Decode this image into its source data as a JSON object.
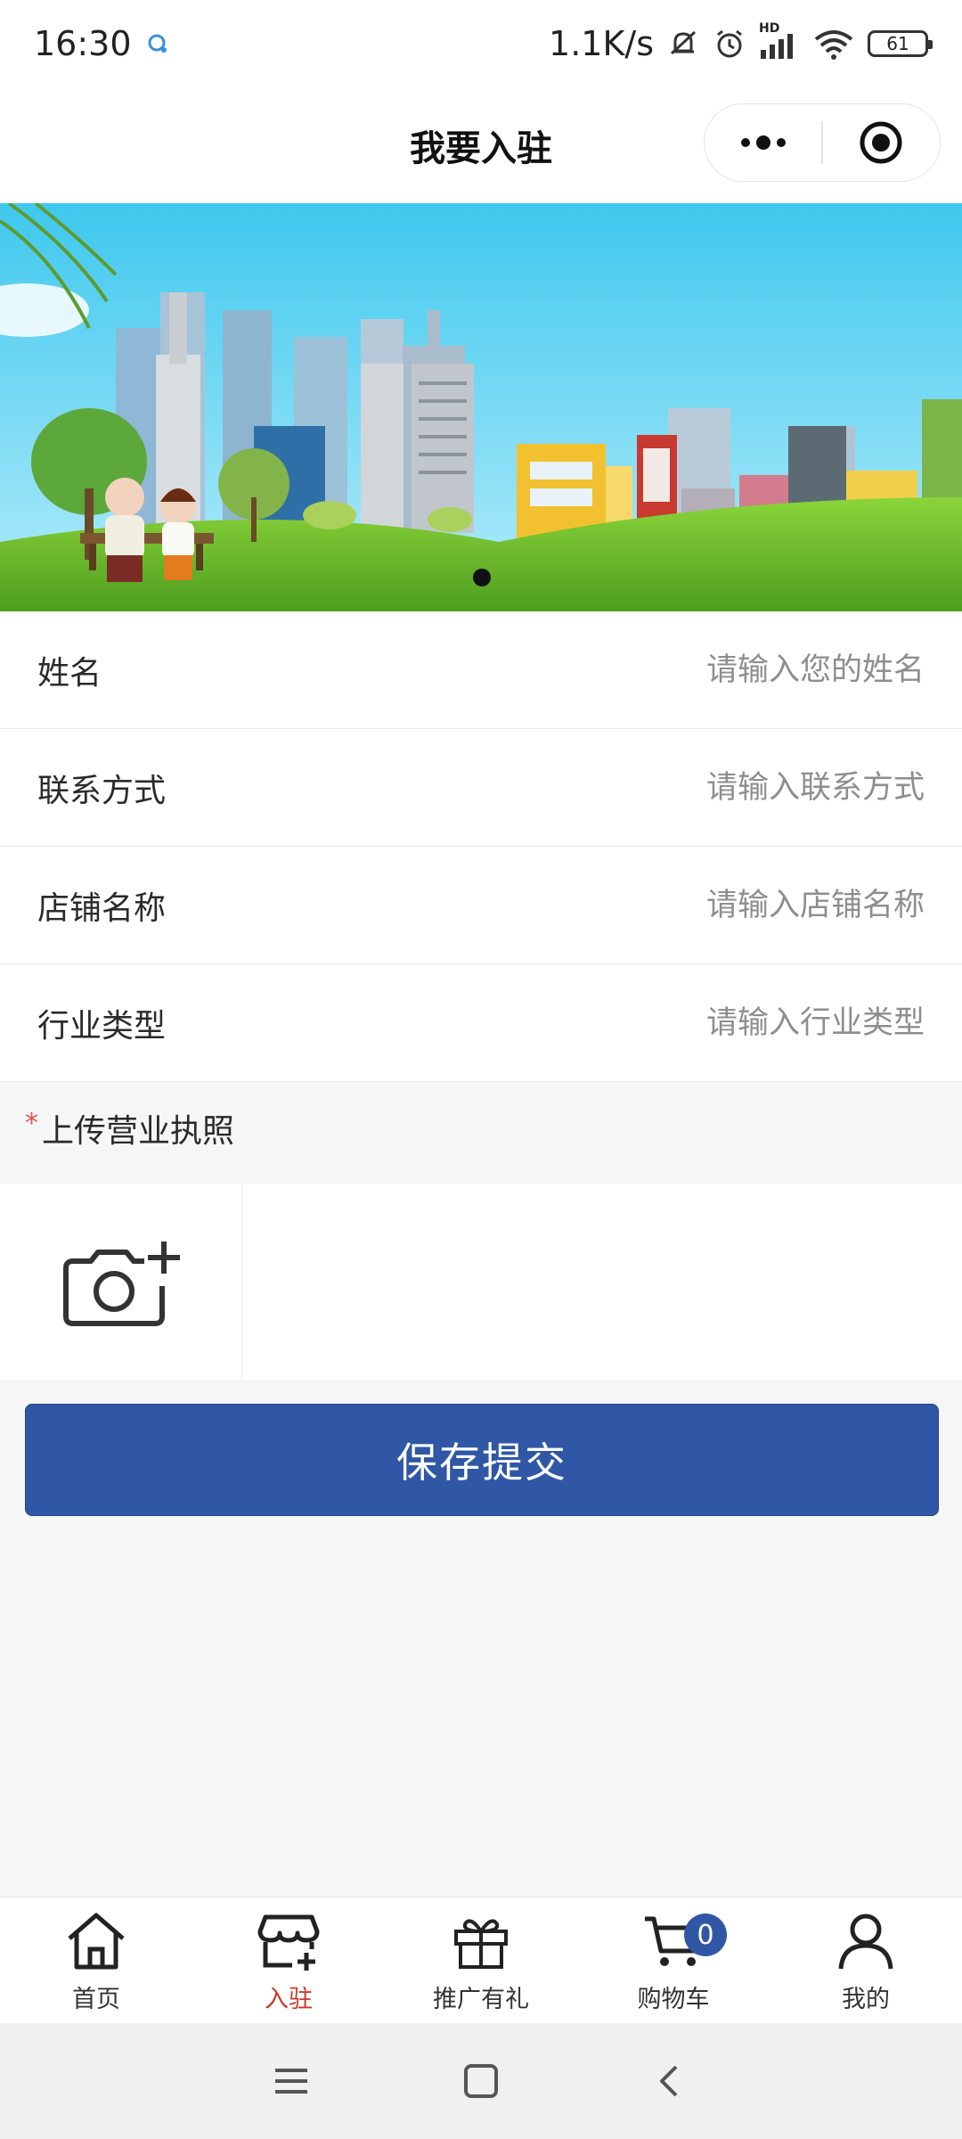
{
  "status_bar": {
    "time": "16:30",
    "network_speed": "1.1K/s",
    "hd_label": "HD",
    "battery_level": "61",
    "colors": {
      "text": "#222222"
    }
  },
  "nav": {
    "title": "我要入驻"
  },
  "banner": {
    "slide_count": 1,
    "active_slide": 1
  },
  "form": {
    "fields": [
      {
        "label": "姓名",
        "placeholder": "请输入您的姓名",
        "value": ""
      },
      {
        "label": "联系方式",
        "placeholder": "请输入联系方式",
        "value": ""
      },
      {
        "label": "店铺名称",
        "placeholder": "请输入店铺名称",
        "value": ""
      },
      {
        "label": "行业类型",
        "placeholder": "请输入行业类型",
        "value": ""
      }
    ],
    "upload_required_mark": "*",
    "upload_label": "上传营业执照",
    "submit_label": "保存提交"
  },
  "tab_bar": {
    "items": [
      {
        "label": "首页",
        "icon": "home-icon",
        "active": false
      },
      {
        "label": "入驻",
        "icon": "store-add-icon",
        "active": true
      },
      {
        "label": "推广有礼",
        "icon": "gift-icon",
        "active": false
      },
      {
        "label": "购物车",
        "icon": "cart-icon",
        "active": false
      },
      {
        "label": "我的",
        "icon": "user-icon",
        "active": false
      }
    ],
    "cart_badge": "0",
    "colors": {
      "active": "#c7392d",
      "badge": "#2f57a6"
    }
  },
  "colors": {
    "primary": "#2f57a6",
    "required": "#e0504e",
    "background": "#f6f6f6"
  }
}
